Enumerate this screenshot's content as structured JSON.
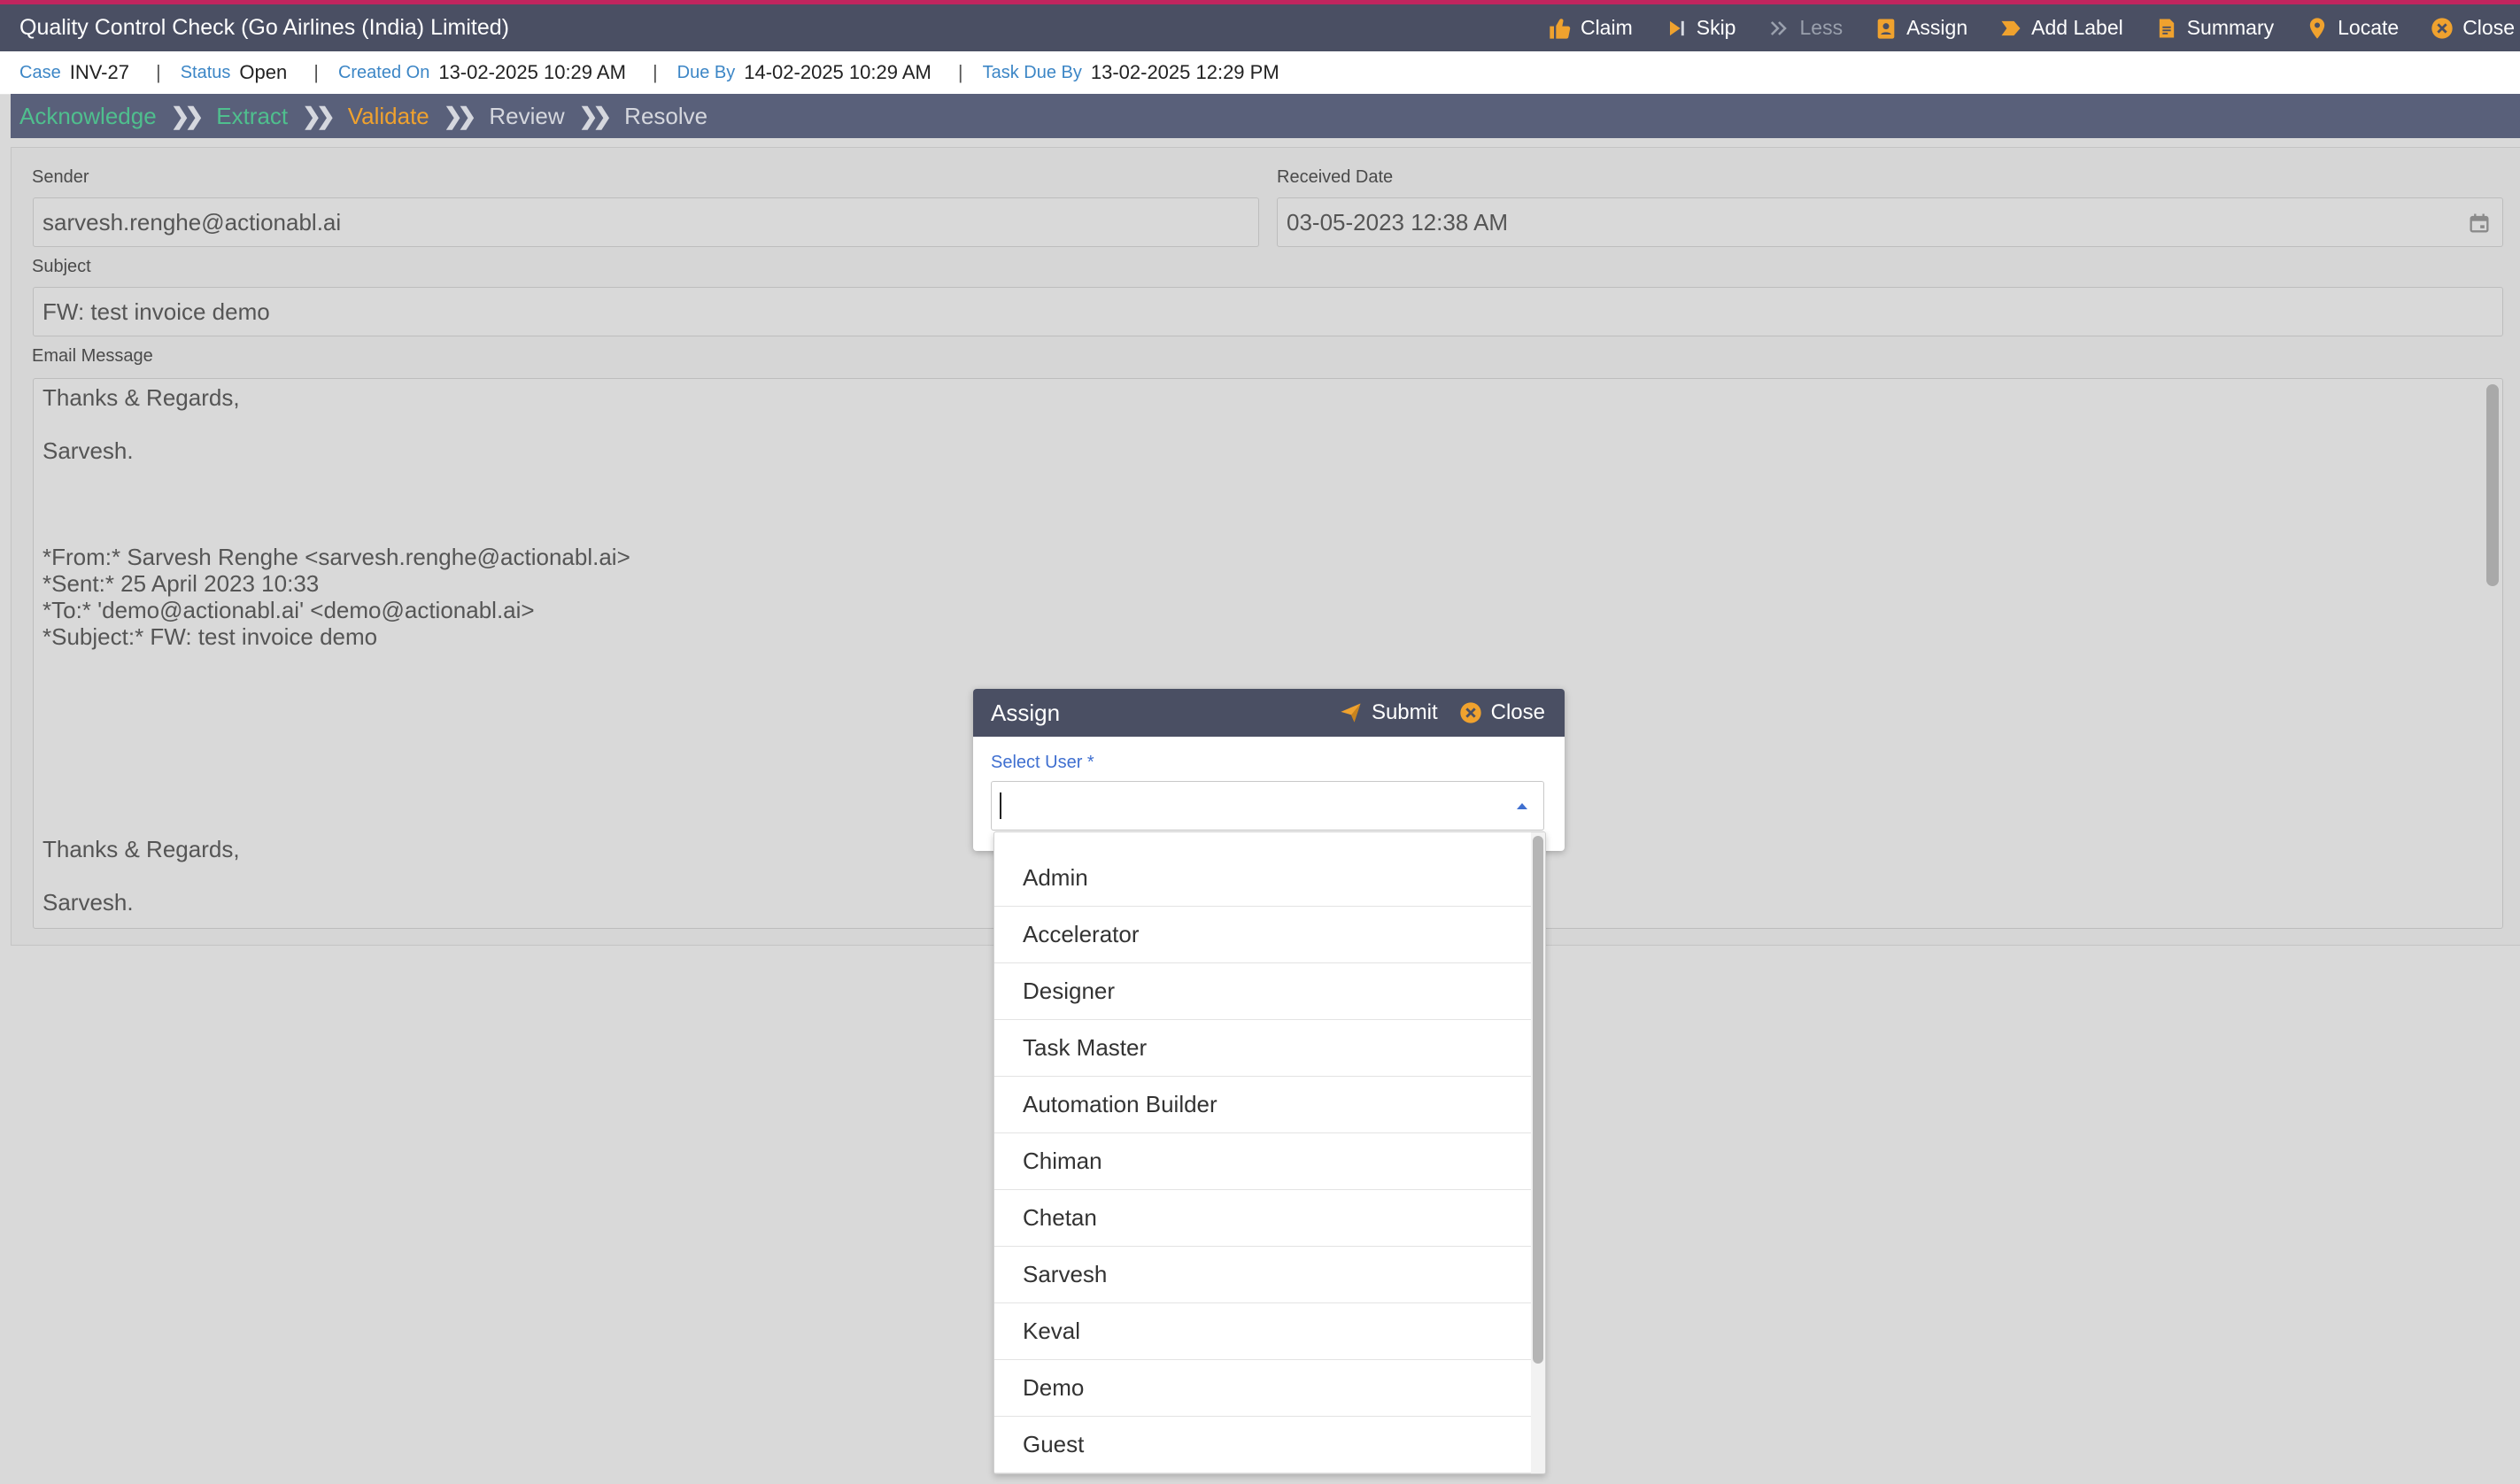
{
  "header": {
    "title": "Quality Control Check (Go Airlines (India) Limited)",
    "toolbar": [
      {
        "label": "Claim",
        "icon": "thumbs-up-icon",
        "dim": false
      },
      {
        "label": "Skip",
        "icon": "skip-icon",
        "dim": false
      },
      {
        "label": "Less",
        "icon": "double-chevron-icon",
        "dim": true
      },
      {
        "label": "Assign",
        "icon": "assign-badge-icon",
        "dim": false
      },
      {
        "label": "Add Label",
        "icon": "label-icon",
        "dim": false
      },
      {
        "label": "Summary",
        "icon": "summary-icon",
        "dim": false
      },
      {
        "label": "Locate",
        "icon": "location-pin-icon",
        "dim": false
      },
      {
        "label": "Close",
        "icon": "close-circle-icon",
        "dim": false
      }
    ]
  },
  "meta": {
    "case_label": "Case",
    "case_value": "INV-27",
    "status_label": "Status",
    "status_value": "Open",
    "created_label": "Created On",
    "created_value": "13-02-2025 10:29 AM",
    "due_label": "Due By",
    "due_value": "14-02-2025 10:29 AM",
    "task_due_label": "Task Due By",
    "task_due_value": "13-02-2025 12:29 PM",
    "separator": "|"
  },
  "steps": [
    {
      "label": "Acknowledge",
      "state": "done"
    },
    {
      "label": "Extract",
      "state": "done"
    },
    {
      "label": "Validate",
      "state": "current"
    },
    {
      "label": "Review",
      "state": "pending"
    },
    {
      "label": "Resolve",
      "state": "pending"
    }
  ],
  "form": {
    "sender_label": "Sender",
    "sender_value": "sarvesh.renghe@actionabl.ai",
    "received_label": "Received Date",
    "received_value": "03-05-2023 12:38 AM",
    "subject_label": "Subject",
    "subject_value": "FW: test invoice demo",
    "message_label": "Email Message",
    "message_lines": [
      "Thanks & Regards,",
      "Sarvesh.",
      "*From:* Sarvesh Renghe <sarvesh.renghe@actionabl.ai>",
      "*Sent:* 25 April 2023 10:33",
      "*To:* 'demo@actionabl.ai' <demo@actionabl.ai>",
      "*Subject:* FW: test invoice demo",
      "Thanks & Regards,",
      "Sarvesh."
    ]
  },
  "dialog": {
    "title": "Assign",
    "submit_label": "Submit",
    "close_label": "Close",
    "select_label": "Select User *",
    "select_value": "",
    "options": [
      "Admin",
      "Accelerator",
      "Designer",
      "Task Master",
      "Automation Builder",
      "Chiman",
      "Chetan",
      "Sarvesh",
      "Keval",
      "Demo",
      "Guest"
    ]
  },
  "colors": {
    "header_bg": "#4a4f63",
    "accent_orange": "#f0a22e",
    "step_done": "#4fbf8e",
    "label_blue": "#3c86c6",
    "top_line": "#c0255e"
  }
}
